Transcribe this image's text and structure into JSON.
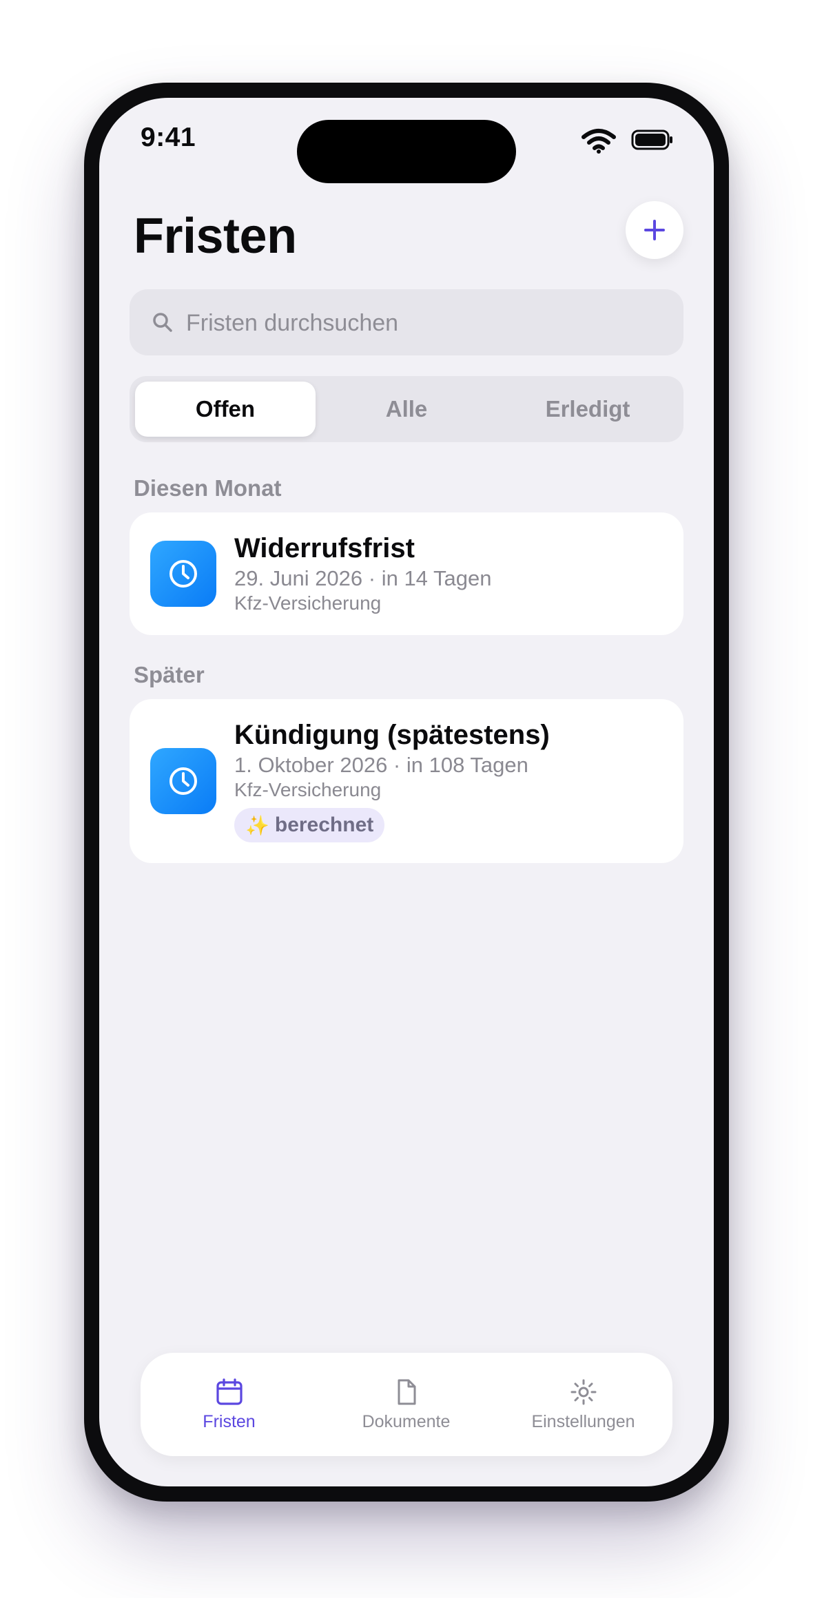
{
  "status_bar": {
    "time": "9:41"
  },
  "header": {
    "title": "Fristen"
  },
  "search": {
    "placeholder": "Fristen durchsuchen"
  },
  "filter": {
    "segments": [
      "Offen",
      "Alle",
      "Erledigt"
    ],
    "selected": "Offen"
  },
  "sections": [
    {
      "header": "Diesen Monat",
      "items": [
        {
          "title": "Widerrufsfrist",
          "subtitle": "29. Juni 2026 · in 14 Tagen",
          "document": "Kfz-Versicherung",
          "icon": "clock-icon"
        }
      ]
    },
    {
      "header": "Später",
      "items": [
        {
          "title": "Kündigung (spätestens)",
          "subtitle": "1. Oktober 2026 · in 108 Tagen",
          "document": "Kfz-Versicherung",
          "icon": "clock-icon",
          "badge": {
            "icon": "✨",
            "label": "berechnet"
          }
        }
      ]
    }
  ],
  "tab_bar": {
    "items": [
      {
        "label": "Fristen",
        "icon": "calendar-icon",
        "active": true
      },
      {
        "label": "Dokumente",
        "icon": "document-icon",
        "active": false
      },
      {
        "label": "Einstellungen",
        "icon": "sun-icon",
        "active": false
      }
    ]
  },
  "colors": {
    "accent": "#5b47e0",
    "icon_blue": "#1a90fb",
    "background": "#f2f1f6"
  }
}
